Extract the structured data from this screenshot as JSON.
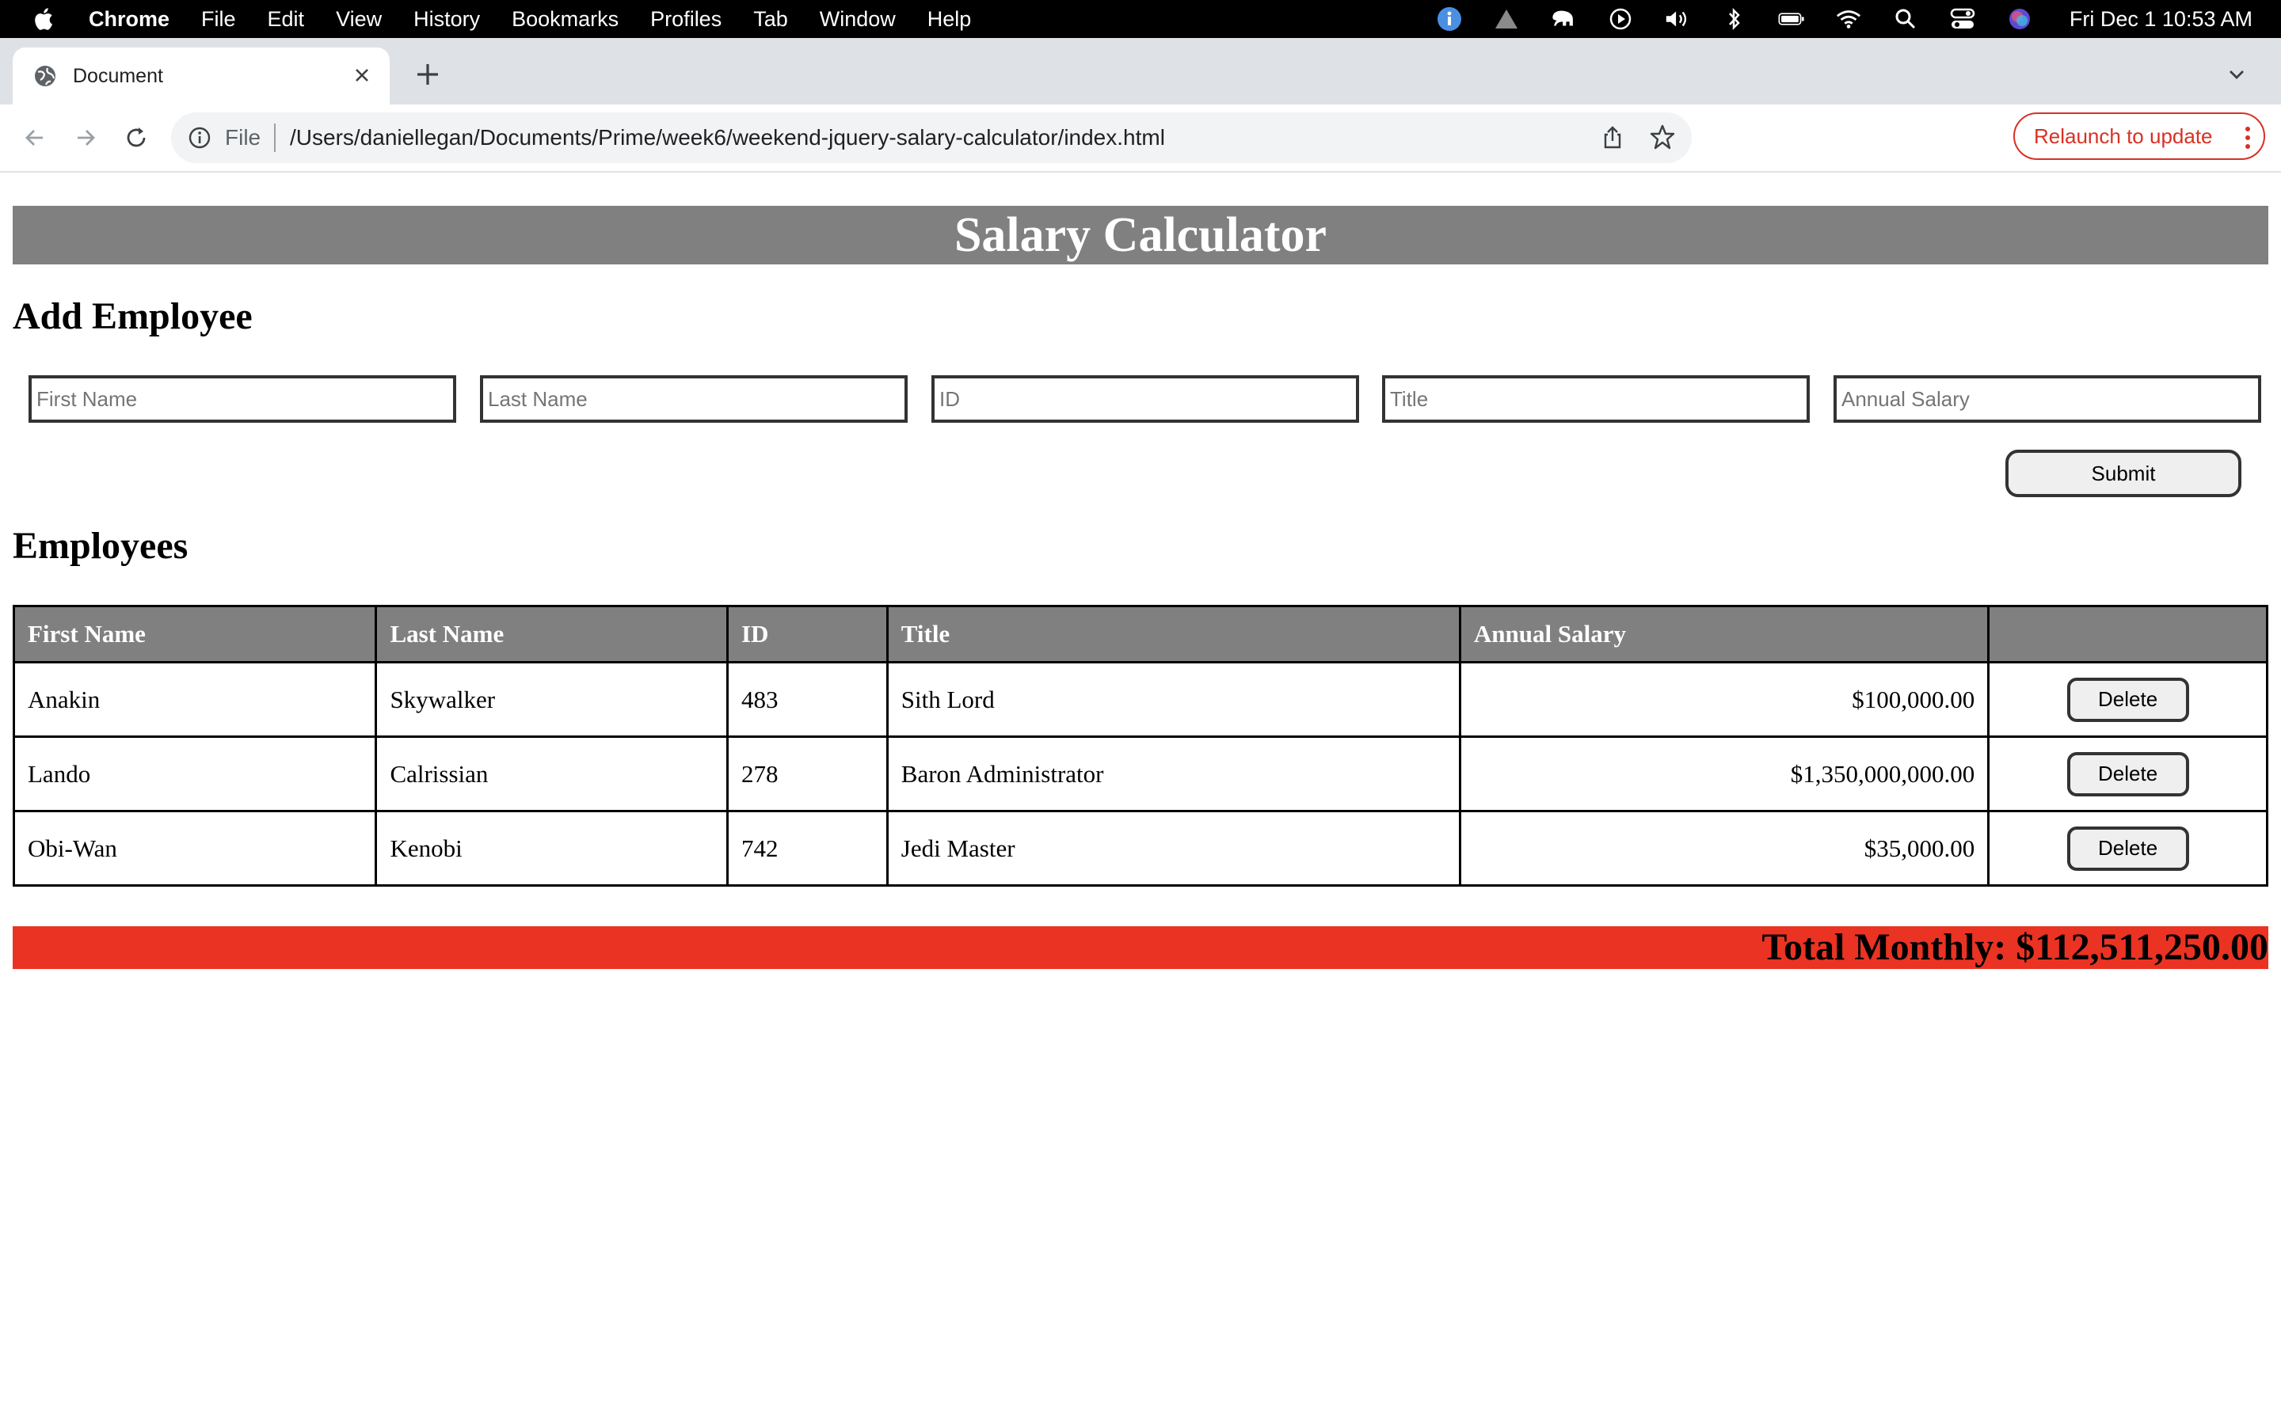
{
  "menubar": {
    "app": "Chrome",
    "items": [
      "File",
      "Edit",
      "View",
      "History",
      "Bookmarks",
      "Profiles",
      "Tab",
      "Window",
      "Help"
    ],
    "clock": "Fri Dec 1  10:53 AM"
  },
  "tab": {
    "title": "Document"
  },
  "omnibox": {
    "scheme_label": "File",
    "url": "/Users/daniellegan/Documents/Prime/week6/weekend-jquery-salary-calculator/index.html"
  },
  "toolbar": {
    "relaunch_label": "Relaunch to update"
  },
  "page": {
    "banner_title": "Salary Calculator",
    "add_heading": "Add Employee",
    "inputs": {
      "first_name_placeholder": "First Name",
      "last_name_placeholder": "Last Name",
      "id_placeholder": "ID",
      "title_placeholder": "Title",
      "salary_placeholder": "Annual Salary"
    },
    "submit_label": "Submit",
    "employees_heading": "Employees",
    "table": {
      "headers": [
        "First Name",
        "Last Name",
        "ID",
        "Title",
        "Annual Salary",
        ""
      ],
      "rows": [
        {
          "first": "Anakin",
          "last": "Skywalker",
          "id": "483",
          "title": "Sith Lord",
          "salary": "$100,000.00",
          "action": "Delete"
        },
        {
          "first": "Lando",
          "last": "Calrissian",
          "id": "278",
          "title": "Baron Administrator",
          "salary": "$1,350,000,000.00",
          "action": "Delete"
        },
        {
          "first": "Obi-Wan",
          "last": "Kenobi",
          "id": "742",
          "title": "Jedi Master",
          "salary": "$35,000.00",
          "action": "Delete"
        }
      ]
    },
    "total_monthly": "Total Monthly: $112,511,250.00"
  },
  "colors": {
    "banner_bg": "#808080",
    "total_bg": "#ea3323",
    "relaunch_accent": "#d93025",
    "tabstrip_bg": "#dee1e6"
  }
}
